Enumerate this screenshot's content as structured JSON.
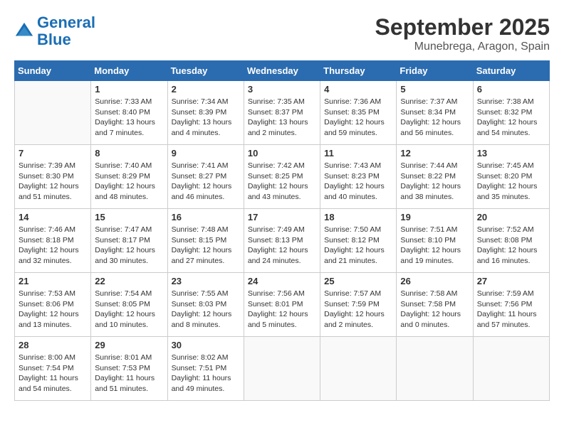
{
  "logo": {
    "line1": "General",
    "line2": "Blue"
  },
  "title": "September 2025",
  "location": "Munebrega, Aragon, Spain",
  "days_header": [
    "Sunday",
    "Monday",
    "Tuesday",
    "Wednesday",
    "Thursday",
    "Friday",
    "Saturday"
  ],
  "weeks": [
    [
      {
        "num": "",
        "info": ""
      },
      {
        "num": "1",
        "info": "Sunrise: 7:33 AM\nSunset: 8:40 PM\nDaylight: 13 hours\nand 7 minutes."
      },
      {
        "num": "2",
        "info": "Sunrise: 7:34 AM\nSunset: 8:39 PM\nDaylight: 13 hours\nand 4 minutes."
      },
      {
        "num": "3",
        "info": "Sunrise: 7:35 AM\nSunset: 8:37 PM\nDaylight: 13 hours\nand 2 minutes."
      },
      {
        "num": "4",
        "info": "Sunrise: 7:36 AM\nSunset: 8:35 PM\nDaylight: 12 hours\nand 59 minutes."
      },
      {
        "num": "5",
        "info": "Sunrise: 7:37 AM\nSunset: 8:34 PM\nDaylight: 12 hours\nand 56 minutes."
      },
      {
        "num": "6",
        "info": "Sunrise: 7:38 AM\nSunset: 8:32 PM\nDaylight: 12 hours\nand 54 minutes."
      }
    ],
    [
      {
        "num": "7",
        "info": "Sunrise: 7:39 AM\nSunset: 8:30 PM\nDaylight: 12 hours\nand 51 minutes."
      },
      {
        "num": "8",
        "info": "Sunrise: 7:40 AM\nSunset: 8:29 PM\nDaylight: 12 hours\nand 48 minutes."
      },
      {
        "num": "9",
        "info": "Sunrise: 7:41 AM\nSunset: 8:27 PM\nDaylight: 12 hours\nand 46 minutes."
      },
      {
        "num": "10",
        "info": "Sunrise: 7:42 AM\nSunset: 8:25 PM\nDaylight: 12 hours\nand 43 minutes."
      },
      {
        "num": "11",
        "info": "Sunrise: 7:43 AM\nSunset: 8:23 PM\nDaylight: 12 hours\nand 40 minutes."
      },
      {
        "num": "12",
        "info": "Sunrise: 7:44 AM\nSunset: 8:22 PM\nDaylight: 12 hours\nand 38 minutes."
      },
      {
        "num": "13",
        "info": "Sunrise: 7:45 AM\nSunset: 8:20 PM\nDaylight: 12 hours\nand 35 minutes."
      }
    ],
    [
      {
        "num": "14",
        "info": "Sunrise: 7:46 AM\nSunset: 8:18 PM\nDaylight: 12 hours\nand 32 minutes."
      },
      {
        "num": "15",
        "info": "Sunrise: 7:47 AM\nSunset: 8:17 PM\nDaylight: 12 hours\nand 30 minutes."
      },
      {
        "num": "16",
        "info": "Sunrise: 7:48 AM\nSunset: 8:15 PM\nDaylight: 12 hours\nand 27 minutes."
      },
      {
        "num": "17",
        "info": "Sunrise: 7:49 AM\nSunset: 8:13 PM\nDaylight: 12 hours\nand 24 minutes."
      },
      {
        "num": "18",
        "info": "Sunrise: 7:50 AM\nSunset: 8:12 PM\nDaylight: 12 hours\nand 21 minutes."
      },
      {
        "num": "19",
        "info": "Sunrise: 7:51 AM\nSunset: 8:10 PM\nDaylight: 12 hours\nand 19 minutes."
      },
      {
        "num": "20",
        "info": "Sunrise: 7:52 AM\nSunset: 8:08 PM\nDaylight: 12 hours\nand 16 minutes."
      }
    ],
    [
      {
        "num": "21",
        "info": "Sunrise: 7:53 AM\nSunset: 8:06 PM\nDaylight: 12 hours\nand 13 minutes."
      },
      {
        "num": "22",
        "info": "Sunrise: 7:54 AM\nSunset: 8:05 PM\nDaylight: 12 hours\nand 10 minutes."
      },
      {
        "num": "23",
        "info": "Sunrise: 7:55 AM\nSunset: 8:03 PM\nDaylight: 12 hours\nand 8 minutes."
      },
      {
        "num": "24",
        "info": "Sunrise: 7:56 AM\nSunset: 8:01 PM\nDaylight: 12 hours\nand 5 minutes."
      },
      {
        "num": "25",
        "info": "Sunrise: 7:57 AM\nSunset: 7:59 PM\nDaylight: 12 hours\nand 2 minutes."
      },
      {
        "num": "26",
        "info": "Sunrise: 7:58 AM\nSunset: 7:58 PM\nDaylight: 12 hours\nand 0 minutes."
      },
      {
        "num": "27",
        "info": "Sunrise: 7:59 AM\nSunset: 7:56 PM\nDaylight: 11 hours\nand 57 minutes."
      }
    ],
    [
      {
        "num": "28",
        "info": "Sunrise: 8:00 AM\nSunset: 7:54 PM\nDaylight: 11 hours\nand 54 minutes."
      },
      {
        "num": "29",
        "info": "Sunrise: 8:01 AM\nSunset: 7:53 PM\nDaylight: 11 hours\nand 51 minutes."
      },
      {
        "num": "30",
        "info": "Sunrise: 8:02 AM\nSunset: 7:51 PM\nDaylight: 11 hours\nand 49 minutes."
      },
      {
        "num": "",
        "info": ""
      },
      {
        "num": "",
        "info": ""
      },
      {
        "num": "",
        "info": ""
      },
      {
        "num": "",
        "info": ""
      }
    ]
  ]
}
